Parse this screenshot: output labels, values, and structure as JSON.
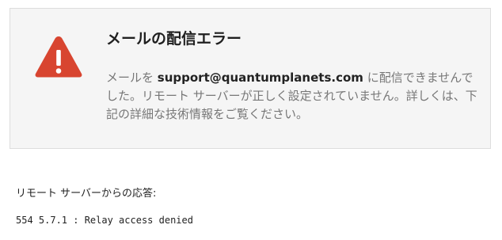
{
  "colors": {
    "card_background": "#f5f5f5",
    "card_border": "#dddddd",
    "warning_red": "#d84530",
    "message_text": "#777777",
    "emphasis_text": "#222222"
  },
  "icon": {
    "name": "warning-triangle-icon"
  },
  "bounce": {
    "title": "メールの配信エラー",
    "message_prefix": "メールを ",
    "recipient": "support@quantumplanets.com",
    "message_suffix": " に配信できませんでした。リモート サーバーが正しく設定されていません。詳しくは、下記の詳細な技術情報をご覧ください。"
  },
  "server_response": {
    "label": "リモート サーバーからの応答:",
    "code": "554 5.7.1 : Relay access denied"
  }
}
